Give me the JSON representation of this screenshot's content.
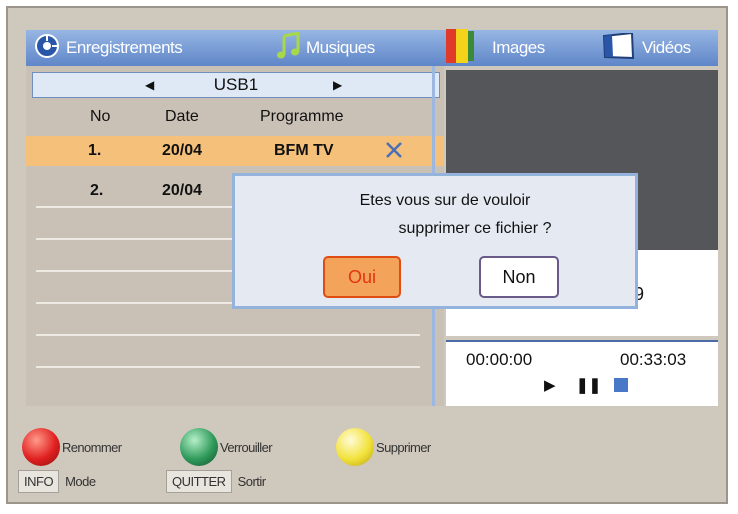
{
  "tabs": [
    {
      "label": "Enregistrements",
      "icon": "recordings-icon"
    },
    {
      "label": "Musiques",
      "icon": "music-note-icon"
    },
    {
      "label": "Images",
      "icon": "images-icon"
    },
    {
      "label": "Vidéos",
      "icon": "video-icon"
    }
  ],
  "source": {
    "label": "USB1"
  },
  "table": {
    "headers": [
      "No",
      "Date",
      "Programme"
    ],
    "rows": [
      {
        "no": "1.",
        "date": "20/04",
        "programme": "BFM TV"
      },
      {
        "no": "2.",
        "date": "20/04",
        "programme": ""
      }
    ]
  },
  "dialog": {
    "line1": "Etes vous sur de vouloir",
    "line2": "supprimer ce fichier ?",
    "yes": "Oui",
    "no": "Non"
  },
  "info_partial": "9",
  "player": {
    "elapsed": "00:00:00",
    "total": "00:33:03"
  },
  "color_actions": [
    {
      "label": "Renommer",
      "color": "#e02020"
    },
    {
      "label": "Verrouiller",
      "color": "#2f9a5a"
    },
    {
      "label": "Supprimer",
      "color": "#f2e23a"
    }
  ],
  "keys": [
    {
      "key": "INFO",
      "label": "Mode"
    },
    {
      "key": "QUITTER",
      "label": "Sortir"
    }
  ]
}
